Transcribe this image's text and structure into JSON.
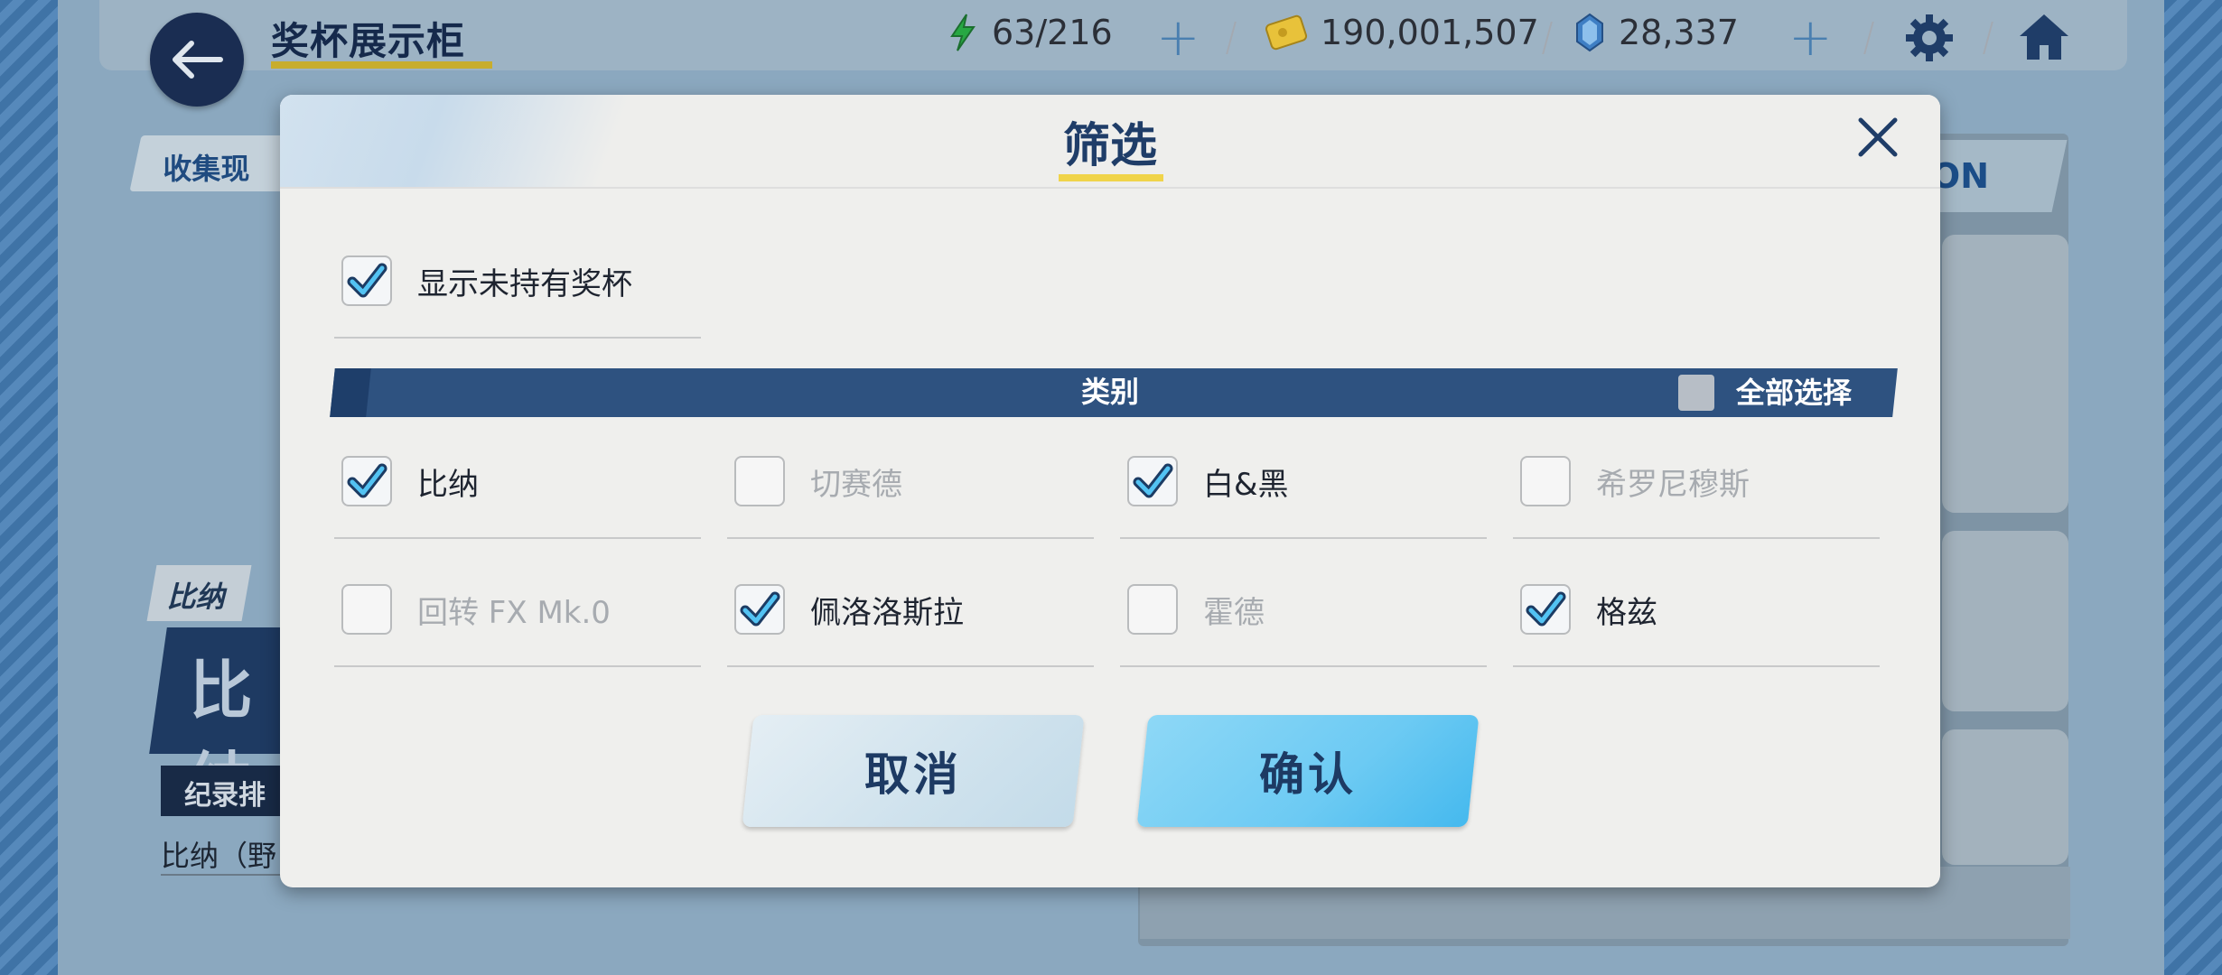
{
  "header": {
    "title": "奖杯展示柜",
    "stamina": "63/216",
    "credits": "190,001,507",
    "gems": "28,337"
  },
  "background": {
    "collection_tag": "收集现",
    "dropdown_text": "ON",
    "character_tag": "比纳",
    "character_big": "比纳",
    "rank_tag": "纪录排",
    "character_line": "比纳（野"
  },
  "dialog": {
    "title": "筛选",
    "show_unowned": {
      "label": "显示未持有奖杯",
      "checked": true
    },
    "category_header": "类别",
    "select_all_label": "全部选择",
    "select_all_checked": false,
    "options": [
      {
        "label": "比纳",
        "checked": true
      },
      {
        "label": "切赛德",
        "checked": false
      },
      {
        "label": "白&黑",
        "checked": true
      },
      {
        "label": "希罗尼穆斯",
        "checked": false
      },
      {
        "label": "回转 FX Mk.0",
        "checked": false
      },
      {
        "label": "佩洛洛斯拉",
        "checked": true
      },
      {
        "label": "霍德",
        "checked": false
      },
      {
        "label": "格兹",
        "checked": true
      }
    ],
    "cancel_label": "取消",
    "confirm_label": "确认"
  },
  "colors": {
    "navy": "#1f3d68",
    "check_blue": "#3cb8f0",
    "confirm_button": "#6ccaf3",
    "category_bar": "#2e5280"
  }
}
